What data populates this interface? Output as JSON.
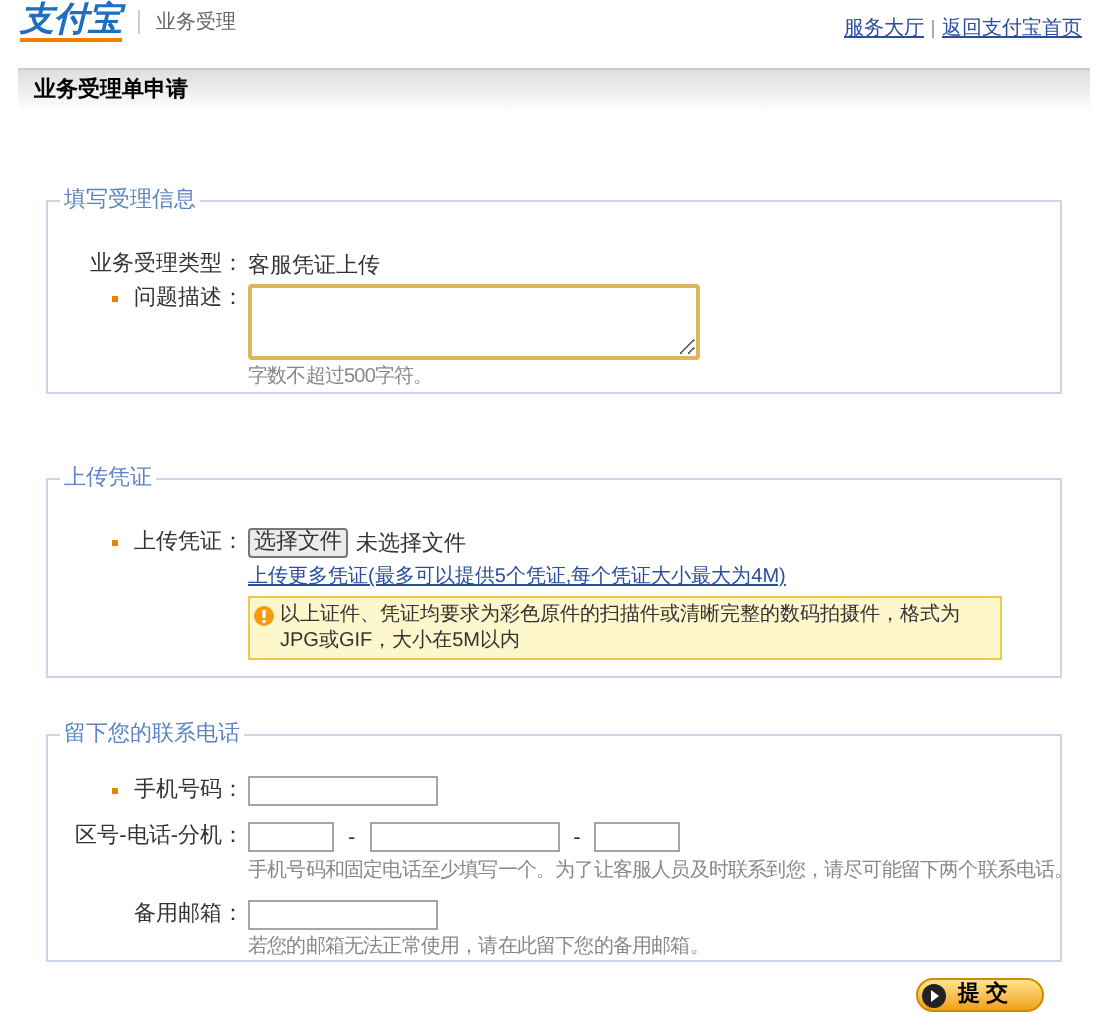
{
  "header": {
    "logo": "支付宝",
    "section": "业务受理",
    "links": [
      "服务大厅",
      "返回支付宝首页"
    ]
  },
  "page_title": "业务受理单申请",
  "sections": [
    {
      "legend": "填写受理信息",
      "rows": [
        {
          "kind": "static",
          "label": "业务受理类型：",
          "required": false,
          "value": "客服凭证上传"
        },
        {
          "kind": "textarea",
          "label": "问题描述：",
          "required": true,
          "hint": "字数不超过500字符。"
        }
      ]
    },
    {
      "legend": "上传凭证",
      "rows": [
        {
          "kind": "file",
          "label": "上传凭证：",
          "required": true,
          "button": "选择文件",
          "status": "未选择文件",
          "link": "上传更多凭证(最多可以提供5个凭证,每个凭证大小最大为4M)",
          "notice": "以上证件、凭证均要求为彩色原件的扫描件或清晰完整的数码拍摄件，格式为JPG或GIF，大小在5M以内"
        }
      ]
    },
    {
      "legend": "留下您的联系电话",
      "rows": [
        {
          "kind": "text",
          "label": "手机号码：",
          "required": true
        },
        {
          "kind": "phone",
          "label": "区号-电话-分机：",
          "required": false,
          "separators": [
            "-",
            "-"
          ],
          "hint": "手机号码和固定电话至少填写一个。为了让客服人员及时联系到您，请尽可能留下两个联系电话。"
        },
        {
          "kind": "text",
          "label": "备用邮箱：",
          "required": false,
          "hint": "若您的邮箱无法正常使用，请在此留下您的备用邮箱。"
        }
      ]
    }
  ],
  "submit": "提 交"
}
